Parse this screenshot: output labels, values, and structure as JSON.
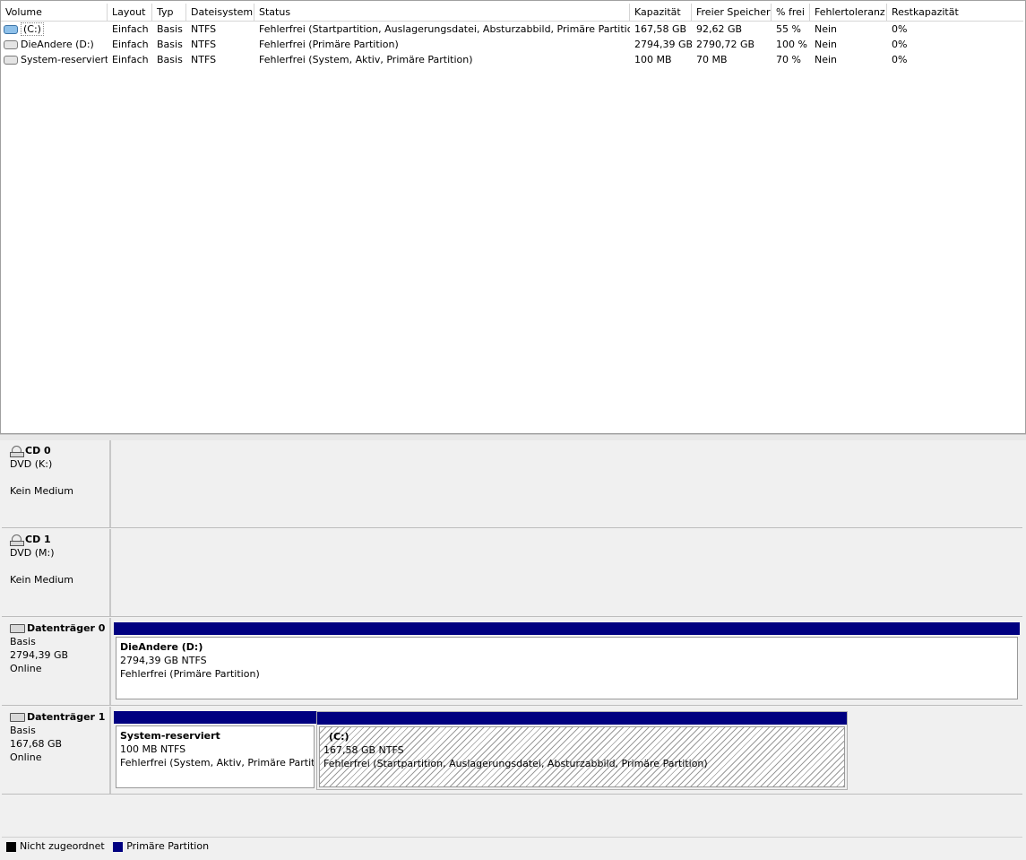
{
  "columns": [
    "Volume",
    "Layout",
    "Typ",
    "Dateisystem",
    "Status",
    "Kapazität",
    "Freier Speicher",
    "% frei",
    "Fehlertoleranz",
    "Restkapazität"
  ],
  "volumes": [
    {
      "name": "(C:)",
      "layout": "Einfach",
      "typ": "Basis",
      "fs": "NTFS",
      "status": "Fehlerfrei (Startpartition, Auslagerungsdatei, Absturzabbild, Primäre Partition)",
      "kapazitaet": "167,58 GB",
      "frei": "92,62 GB",
      "prozent": "55 %",
      "fehlertoleranz": "Nein",
      "rest": "0%",
      "icon": "volume-blue-icon"
    },
    {
      "name": "DieAndere (D:)",
      "layout": "Einfach",
      "typ": "Basis",
      "fs": "NTFS",
      "status": "Fehlerfrei (Primäre Partition)",
      "kapazitaet": "2794,39 GB",
      "frei": "2790,72 GB",
      "prozent": "100 %",
      "fehlertoleranz": "Nein",
      "rest": "0%",
      "icon": "volume-gray-icon"
    },
    {
      "name": "System-reserviert",
      "layout": "Einfach",
      "typ": "Basis",
      "fs": "NTFS",
      "status": "Fehlerfrei (System, Aktiv, Primäre Partition)",
      "kapazitaet": "100 MB",
      "frei": "70 MB",
      "prozent": "70 %",
      "fehlertoleranz": "Nein",
      "rest": "0%",
      "icon": "volume-gray-icon"
    }
  ],
  "disks": {
    "cd0": {
      "title": "CD 0",
      "line1": "DVD (K:)",
      "line3": "Kein Medium"
    },
    "cd1": {
      "title": "CD 1",
      "line1": "DVD (M:)",
      "line3": "Kein Medium"
    },
    "disk0": {
      "title": "Datenträger 0",
      "typ": "Basis",
      "size": "2794,39 GB",
      "state": "Online",
      "partitions": [
        {
          "name": "DieAndere  (D:)",
          "size": "2794,39 GB NTFS",
          "status": "Fehlerfrei (Primäre Partition)"
        }
      ]
    },
    "disk1": {
      "title": "Datenträger 1",
      "typ": "Basis",
      "size": "167,68 GB",
      "state": "Online",
      "partitions": [
        {
          "name": "System-reserviert",
          "size": "100 MB NTFS",
          "status": "Fehlerfrei (System, Aktiv, Primäre Partition)"
        },
        {
          "name": "(C:)",
          "size": "167,58 GB NTFS",
          "status": "Fehlerfrei (Startpartition, Auslagerungsdatei, Absturzabbild, Primäre Partition)"
        }
      ]
    }
  },
  "legend": [
    {
      "label": "Nicht zugeordnet",
      "color": "#000000"
    },
    {
      "label": "Primäre Partition",
      "color": "#000080"
    }
  ]
}
